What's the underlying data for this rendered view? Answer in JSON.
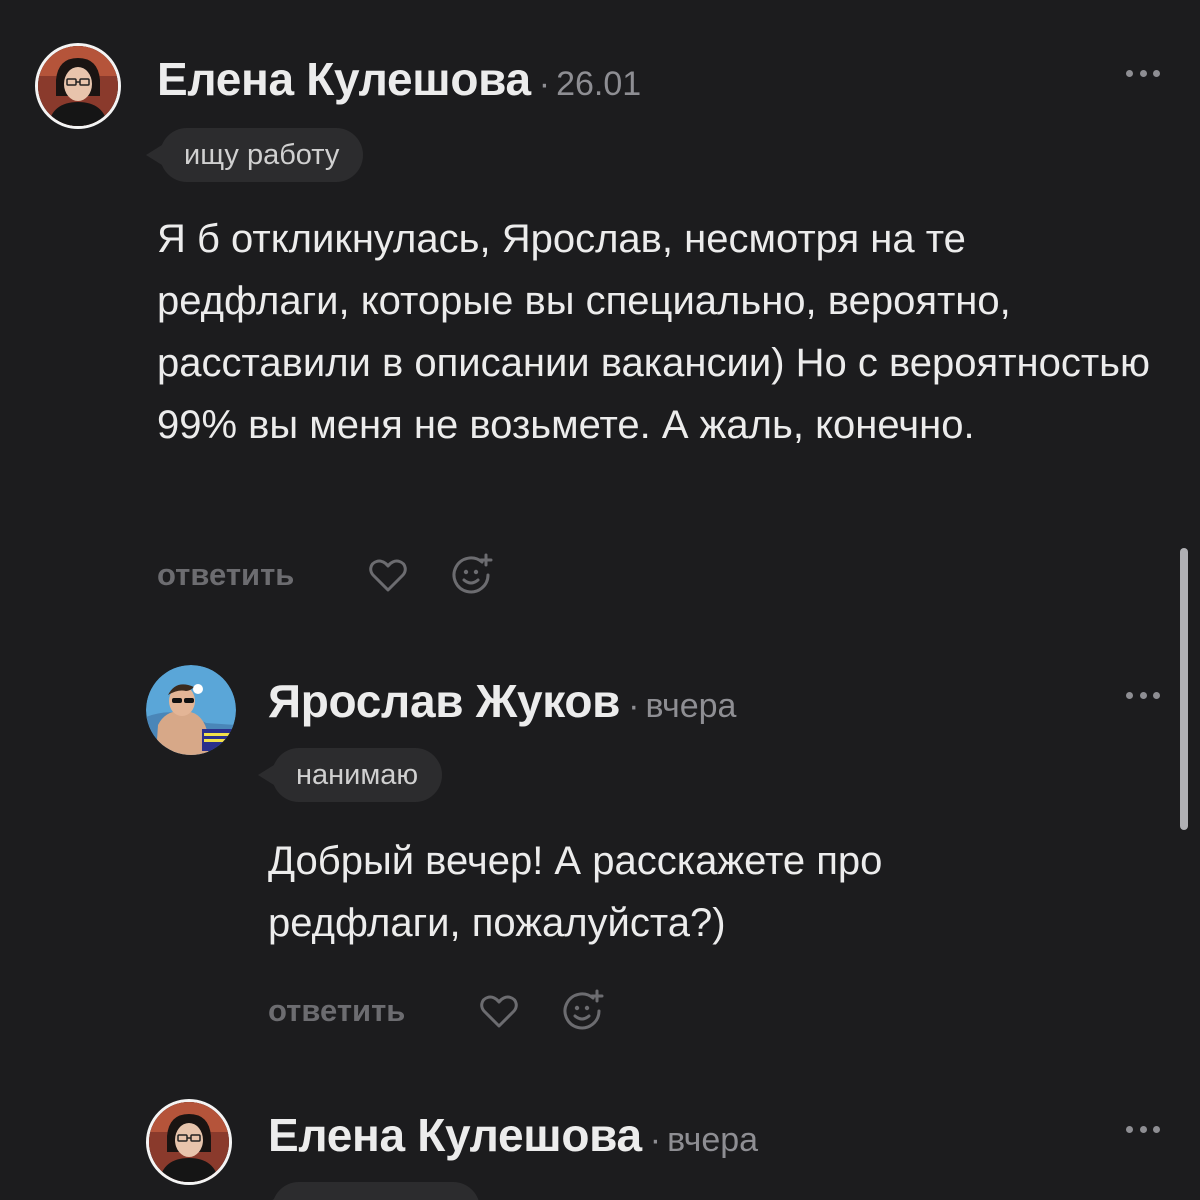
{
  "comments": [
    {
      "author": "Елена Кулешова",
      "separator": "·",
      "date": "26.01",
      "tag": "ищу работу",
      "text": "Я б откликнулась, Ярослав, несмотря на те редфлаги, которые вы специально, вероятно, расставили в описании вакансии) Но с вероятностью 99% вы меня не возьмете. А жаль, конечно.",
      "reply_label": "ответить",
      "icons": {
        "like": "heart-icon",
        "react": "emoji-add-icon",
        "more": "more-dots-icon"
      }
    },
    {
      "author": "Ярослав Жуков",
      "separator": "·",
      "date": "вчера",
      "tag": "нанимаю",
      "text": "Добрый вечер! А расскажете про редфлаги, пожалуйста?)",
      "reply_label": "ответить",
      "icons": {
        "like": "heart-icon",
        "react": "emoji-add-icon",
        "more": "more-dots-icon"
      }
    },
    {
      "author": "Елена Кулешова",
      "separator": "·",
      "date": "вчера",
      "icons": {
        "more": "more-dots-icon"
      }
    }
  ],
  "colors": {
    "background": "#1c1c1e",
    "text": "#ececec",
    "muted": "#8e8e93",
    "tag_bg": "#2c2c2e",
    "action": "#6c6c70"
  }
}
